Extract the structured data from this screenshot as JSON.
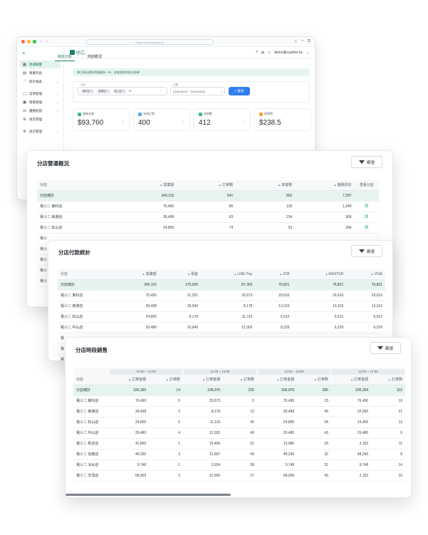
{
  "browser": {
    "url": "https://www.cashier.tw",
    "dots": [
      "#ff5f57",
      "#febc2e",
      "#28c840"
    ]
  },
  "app": {
    "brand": "小二",
    "user": "demo@cashier.tw"
  },
  "sidebar": {
    "items": [
      {
        "icon": "▦",
        "label": "營運概覽",
        "active": true
      },
      {
        "icon": "▤",
        "label": "營業列表"
      },
      {
        "icon": "⟋",
        "label": "統計報表",
        "caret": true
      },
      {
        "icon": "▢",
        "label": "菜單管理",
        "caret": true
      },
      {
        "icon": "▣",
        "label": "營業管理",
        "caret": true
      },
      {
        "icon": "⊟",
        "label": "優惠促銷",
        "caret": true
      },
      {
        "icon": "⊞",
        "label": "商店管理",
        "caret": true
      },
      {
        "icon": "⚙",
        "label": "商店管理",
        "caret": true
      }
    ]
  },
  "page": {
    "tabs": [
      "跨店分析",
      "商店概況"
    ],
    "notice": "單日資料通知時間最多一年，依查詢需求給出結果",
    "filter": {
      "store_label": "分店",
      "chips": [
        "東科店",
        "南港店",
        "松山店"
      ],
      "more": "+5",
      "date_label": "日期",
      "date_range": "2024-06-01 ~ 2024-06-01",
      "query": "查詢"
    },
    "stats": [
      {
        "label": "營業金額",
        "value": "$93,760",
        "color": "#3fb98d"
      },
      {
        "label": "有效訂單",
        "value": "400",
        "color": "#5aa6f0"
      },
      {
        "label": "來客數",
        "value": "412",
        "color": "#3fb98d"
      },
      {
        "label": "客單價",
        "value": "$238.5",
        "color": "#f5a23c"
      }
    ]
  },
  "overview": {
    "title": "分店營運概況",
    "filter_label": "篩選",
    "headers": [
      "分店",
      "營業額",
      "訂單數",
      "來客數",
      "優惠折扣",
      "查看分店"
    ],
    "total": [
      "分店總計",
      "340,110",
      "541",
      "862",
      "7,297"
    ],
    "rows": [
      [
        "電小二 東科店",
        "76,490",
        "80",
        "126",
        "1,249"
      ],
      [
        "電小二 南港店",
        "39,498",
        "63",
        "234",
        "909"
      ],
      [
        "電小二 松山店",
        "24,805",
        "74",
        "53",
        "284"
      ]
    ],
    "hidden_rows": [
      "電小",
      "電小",
      "電小",
      "電小",
      "電小"
    ]
  },
  "payments": {
    "title": "分店付款統計",
    "filter_label": "篩選",
    "headers": [
      "分店",
      "營業額",
      "現金",
      "LINE Pay",
      "JCB",
      "MASTER",
      "VISA"
    ],
    "total": [
      "分店總計",
      "340,110",
      "175,926",
      "87,363",
      "76,821",
      "76,821",
      "76,821"
    ],
    "rows": [
      [
        "電小二 東科店",
        "76,490",
        "21,201",
        "25,673",
        "29,616",
        "29,616",
        "29,616"
      ],
      [
        "電小二 南港店",
        "39,498",
        "18,004",
        "8,178",
        "13,316",
        "13,316",
        "13,316"
      ],
      [
        "電小二 松山店",
        "24,805",
        "8,178",
        "11,115",
        "5,512",
        "5,512",
        "5,512"
      ],
      [
        "電小二 中山店",
        "29,480",
        "10,949",
        "12,302",
        "8,229",
        "6,229",
        "6,229"
      ]
    ],
    "hidden_rows": [
      "電",
      "電",
      "電"
    ]
  },
  "timeslots": {
    "title": "分店時段銷售",
    "filter_label": "篩選",
    "groups": [
      "10:00 ~ 11:00",
      "11:00 ~ 12:00",
      "12:00 ~ 13:00",
      "13:00 ~ 14:00"
    ],
    "store_header": "分店",
    "amount_header": "訂單金額",
    "count_header": "訂單數",
    "total": [
      "分店總計",
      "336,390",
      "14",
      "108,976",
      "225",
      "309,976",
      "285",
      "205,324",
      "110"
    ],
    "rows": [
      [
        "電小二 東科店",
        "76,490",
        "0",
        "25,673",
        "5",
        "76,490",
        "23",
        "76,490",
        "19"
      ],
      [
        "電小二 南港店",
        "39,498",
        "2",
        "8,178",
        "12",
        "39,498",
        "49",
        "22,900",
        "21"
      ],
      [
        "電小二 松山店",
        "24,805",
        "0",
        "11,115",
        "30",
        "24,805",
        "34",
        "15,406",
        "12"
      ],
      [
        "電小二 中山店",
        "29,480",
        "4",
        "12,302",
        "49",
        "29,480",
        "43",
        "29,480",
        "9"
      ],
      [
        "電小二 新店店",
        "42,890",
        "1",
        "15,406",
        "21",
        "13,080",
        "29",
        "2,152",
        "11"
      ],
      [
        "電小二 信義店",
        "48,290",
        "3",
        "22,897",
        "43",
        "48,290",
        "32",
        "48,290",
        "8"
      ],
      [
        "電小二 淡水店",
        "9,748",
        "1",
        "3,924",
        "38",
        "9,748",
        "32",
        "9,748",
        "14"
      ],
      [
        "電小二 天母店",
        "68,909",
        "3",
        "22,900",
        "27",
        "68,909",
        "43",
        "2,152",
        "16"
      ]
    ]
  }
}
